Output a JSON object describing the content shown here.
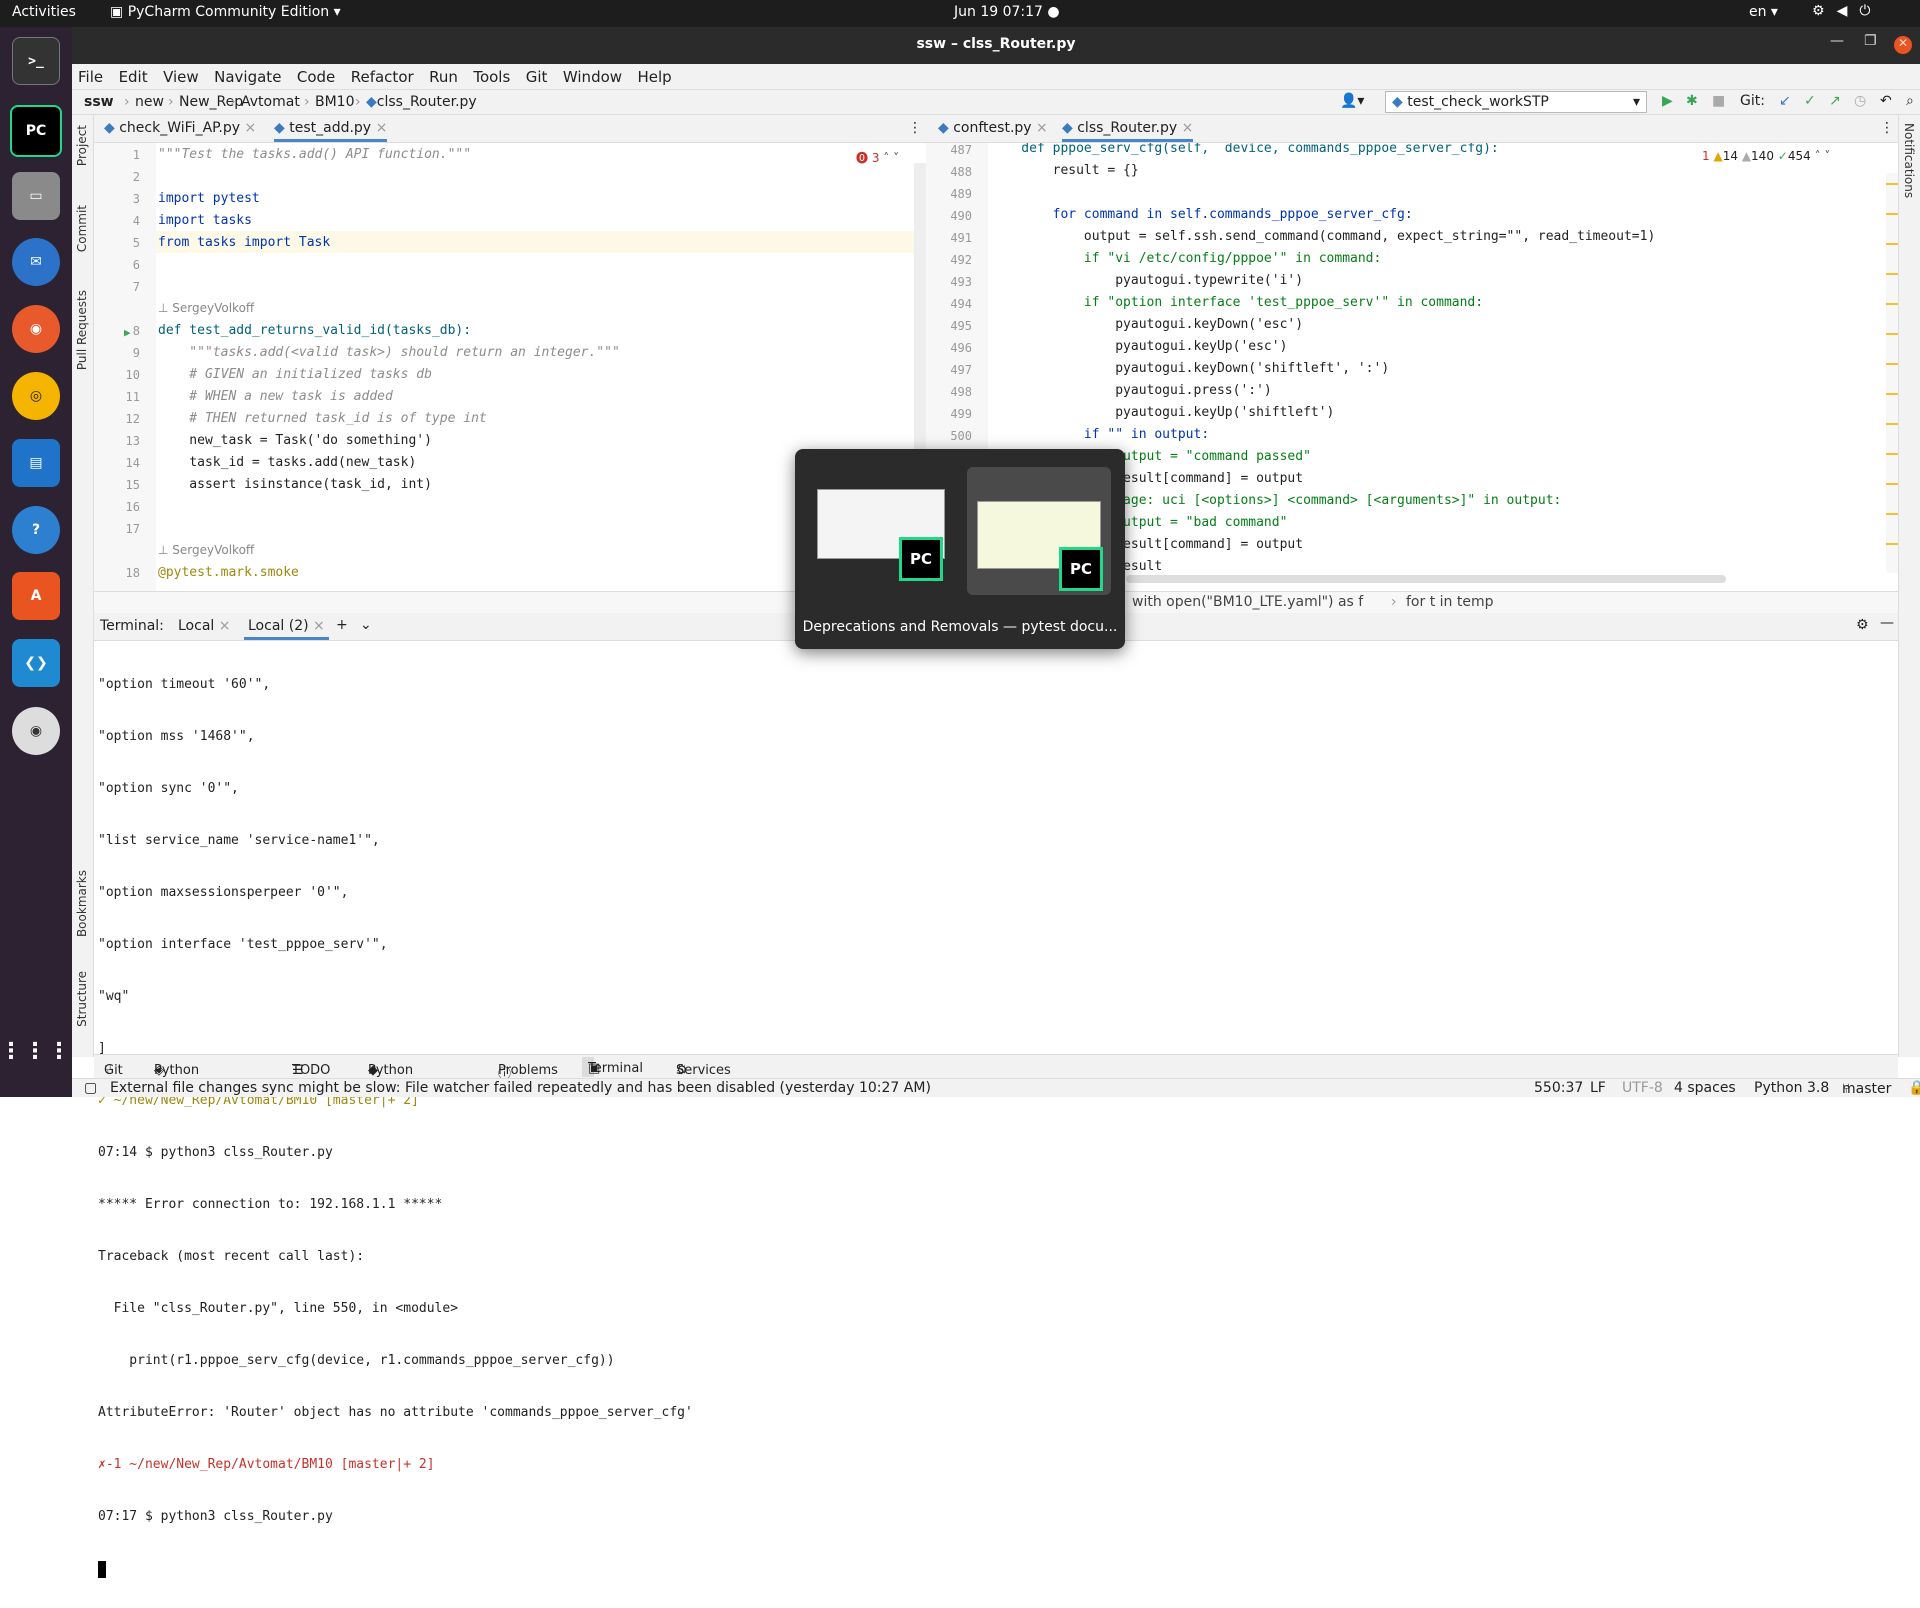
{
  "topbar": {
    "activities": "Activities",
    "app_name": "PyCharm Community Edition ▾",
    "clock": "Jun 19  07:17",
    "lang": "en ▾"
  },
  "window": {
    "title": "ssw – clss_Router.py"
  },
  "menu": [
    "File",
    "Edit",
    "View",
    "Navigate",
    "Code",
    "Refactor",
    "Run",
    "Tools",
    "Git",
    "Window",
    "Help"
  ],
  "breadcrumb": [
    "ssw",
    "new",
    "New_Rep",
    "Avtomat",
    "BM10",
    "clss_Router.py"
  ],
  "run_config": "test_check_workSTP",
  "git_label": "Git:",
  "side_left": {
    "project": "Project",
    "commit": "Commit",
    "pull_requests": "Pull Requests",
    "bookmarks": "Bookmarks",
    "structure": "Structure"
  },
  "side_right": {
    "notifications": "Notifications"
  },
  "left_tabs": [
    "check_WiFi_AP.py",
    "test_add.py"
  ],
  "right_tabs": [
    "conftest.py",
    "clss_Router.py"
  ],
  "left_editor": {
    "error_count": "3",
    "author_hint": "SergeyVolkoff",
    "lines": [
      {
        "n": "1",
        "text": "\"\"\"Test the tasks.add() API function.\"\"\""
      },
      {
        "n": "2",
        "text": ""
      },
      {
        "n": "3",
        "text": "import pytest"
      },
      {
        "n": "4",
        "text": "import tasks"
      },
      {
        "n": "5",
        "text": "from tasks import Task"
      },
      {
        "n": "6",
        "text": ""
      },
      {
        "n": "7",
        "text": ""
      },
      {
        "n": "8",
        "text": "def test_add_returns_valid_id(tasks_db):"
      },
      {
        "n": "9",
        "text": "    \"\"\"tasks.add(<valid task>) should return an integer.\"\"\""
      },
      {
        "n": "10",
        "text": "    # GIVEN an initialized tasks db"
      },
      {
        "n": "11",
        "text": "    # WHEN a new task is added"
      },
      {
        "n": "12",
        "text": "    # THEN returned task_id is of type int"
      },
      {
        "n": "13",
        "text": "    new_task = Task('do something')"
      },
      {
        "n": "14",
        "text": "    task_id = tasks.add(new_task)"
      },
      {
        "n": "15",
        "text": "    assert isinstance(task_id, int)"
      },
      {
        "n": "16",
        "text": ""
      },
      {
        "n": "17",
        "text": ""
      },
      {
        "n": "18",
        "text": "@pytest.mark.smoke"
      }
    ]
  },
  "right_editor": {
    "errors": "1",
    "warnings": "14",
    "weak": "140",
    "ok": "454",
    "lines": [
      {
        "n": "487",
        "text": "    def pppoe_serv_cfg(self,  device, commands_pppoe_server_cfg):"
      },
      {
        "n": "488",
        "text": "        result = {}"
      },
      {
        "n": "489",
        "text": ""
      },
      {
        "n": "490",
        "text": "        for command in self.commands_pppoe_server_cfg:"
      },
      {
        "n": "491",
        "text": "            output = self.ssh.send_command(command, expect_string=\"\", read_timeout=1)"
      },
      {
        "n": "492",
        "text": "            if \"vi /etc/config/pppoe'\" in command:"
      },
      {
        "n": "493",
        "text": "                pyautogui.typewrite('i')"
      },
      {
        "n": "494",
        "text": "            if \"option interface 'test_pppoe_serv'\" in command:"
      },
      {
        "n": "495",
        "text": "                pyautogui.keyDown('esc')"
      },
      {
        "n": "496",
        "text": "                pyautogui.keyUp('esc')"
      },
      {
        "n": "497",
        "text": "                pyautogui.keyDown('shiftleft', ':')"
      },
      {
        "n": "498",
        "text": "                pyautogui.press(':')"
      },
      {
        "n": "499",
        "text": "                pyautogui.keyUp('shiftleft')"
      },
      {
        "n": "500",
        "text": "            if \"\" in output:"
      },
      {
        "n": "",
        "text": "                output = \"command passed\""
      },
      {
        "n": "",
        "text": "                result[command] = output"
      },
      {
        "n": "",
        "text": "              \"Usage: uci [<options>] <command> [<arguments>]\" in output:"
      },
      {
        "n": "",
        "text": "                output = \"bad command\""
      },
      {
        "n": "",
        "text": "                result[command] = output"
      },
      {
        "n": "",
        "text": "                result"
      }
    ],
    "breadcrumb": [
      "with open(\"BM10_LTE.yaml\") as f",
      "for t in temp"
    ]
  },
  "terminal": {
    "label": "Terminal:",
    "tabs": [
      "Local",
      "Local (2)"
    ],
    "lines": [
      "\"option timeout '60'\",",
      "\"option mss '1468'\",",
      "\"option sync '0'\",",
      "\"list service_name 'service-name1'\",",
      "\"option maxsessionsperpeer '0'\",",
      "\"option interface 'test_pppoe_serv'\",",
      "\"wq\"",
      "]",
      "✓ ~/new/New_Rep/Avtomat/BM10 [master|+ 2]",
      "07:14 $ python3 clss_Router.py",
      "***** Error connection to: 192.168.1.1 *****",
      "Traceback (most recent call last):",
      "  File \"clss_Router.py\", line 550, in <module>",
      "    print(r1.pppoe_serv_cfg(device, r1.commands_pppoe_server_cfg))",
      "AttributeError: 'Router' object has no attribute 'commands_pppoe_server_cfg'",
      "✗-1 ~/new/New_Rep/Avtomat/BM10 [master|+ 2]",
      "07:17 $ python3 clss_Router.py"
    ]
  },
  "bottom_tabs": [
    "Git",
    "Python Packages",
    "TODO",
    "Python Console",
    "Problems",
    "Terminal",
    "Services"
  ],
  "status": {
    "message": "External file changes sync might be slow: File watcher failed repeatedly and has been disabled (yesterday 10:27 AM)",
    "position": "550:37",
    "line_sep": "LF",
    "encoding": "UTF-8",
    "indent": "4 spaces",
    "interpreter": "Python 3.8",
    "branch": "master"
  },
  "switcher": {
    "caption": "Deprecations and Removals — pytest docu...",
    "badge": "PC"
  },
  "colors": {
    "accent": "#4a86c7",
    "dock": "#2d2232",
    "keyword": "#0033b3",
    "string": "#067d17",
    "comment": "#8c8c8c"
  }
}
